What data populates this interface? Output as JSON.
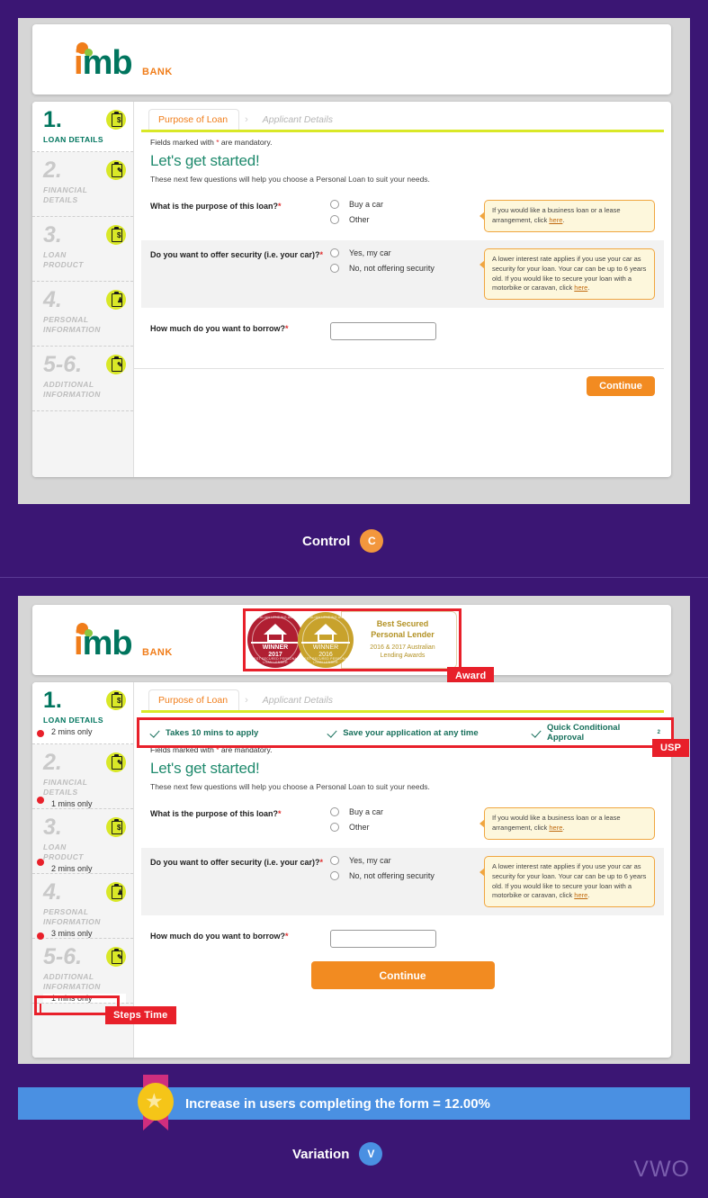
{
  "meta": {
    "tool_logo": "VWO",
    "bg_color": "#3b1674",
    "panel_color": "#d6d6d6"
  },
  "brand": {
    "name_i": "i",
    "name_mb": "mb",
    "suffix": "BANK"
  },
  "form": {
    "tabs": {
      "active": "Purpose of Loan",
      "separator": "›",
      "inactive": "Applicant Details"
    },
    "mandatory_note_pre": "Fields marked with ",
    "mandatory_star": "*",
    "mandatory_note_post": " are mandatory.",
    "headline": "Let's get started!",
    "subhead": "These next few questions will help you choose a Personal Loan to suit your needs.",
    "questions": [
      {
        "label": "What is the purpose of this loan?",
        "required": "*",
        "options": [
          "Buy a car",
          "Other"
        ],
        "tip_pre": "If you would like a business loan or a lease arrangement, click ",
        "tip_link": "here",
        "tip_post": "."
      },
      {
        "label": "Do you want to offer security (i.e. your car)?",
        "required": "*",
        "options": [
          "Yes, my car",
          "No, not offering security"
        ],
        "tip_pre": "A lower interest rate applies if you use your car as security for your loan. Your car can be up to 6 years old. If you would like to secure your loan with a motorbike or caravan, click ",
        "tip_link": "here",
        "tip_post": "."
      }
    ],
    "amount_question": {
      "label": "How much do you want to borrow?",
      "required": "*",
      "value": "",
      "placeholder": ""
    },
    "continue_label": "Continue",
    "continue_color": "#f28b21"
  },
  "sidebar": {
    "steps": [
      {
        "num": "1.",
        "label": "LOAN DETAILS",
        "icon": "clipboard-dollar-icon",
        "time": "2 mins only",
        "active": true
      },
      {
        "num": "2.",
        "label": "FINANCIAL DETAILS",
        "icon": "clipboard-pen-icon",
        "time": "1 mins only",
        "active": false
      },
      {
        "num": "3.",
        "label": "LOAN PRODUCT",
        "icon": "magnifier-dollar-icon",
        "time": "2 mins only",
        "active": false
      },
      {
        "num": "4.",
        "label": "PERSONAL INFORMATION",
        "icon": "clipboard-person-icon",
        "time": "3 mins only",
        "active": false
      },
      {
        "num": "5-6.",
        "label": "ADDITIONAL INFORMATION",
        "icon": "clipboard-pen-icon",
        "time": "1 mins only",
        "active": false
      }
    ]
  },
  "variation_extras": {
    "award": {
      "medal_red": {
        "arc_top": "AUSTRALIAN LENDING AWARDS",
        "winner": "WINNER",
        "year": "2017",
        "arc_bottom": "BEST SECURED PERSONAL LOAN LENDER",
        "color": "#b01f32"
      },
      "medal_gold": {
        "arc_top": "AUSTRALIAN LENDING AWARDS",
        "winner": "WINNER",
        "year": "2016",
        "arc_bottom": "BEST SECURED PERSONAL LOAN LENDER",
        "color": "#c8a22c"
      },
      "title": "Best Secured Personal Lender",
      "subtitle": "2016 & 2017 Australian Lending Awards"
    },
    "usp": [
      "Takes 10 mins to apply",
      "Save your application at any time",
      "Quick Conditional Approval"
    ],
    "usp_superscript": "2"
  },
  "annotations": {
    "award_tag": "Award",
    "usp_tag": "USP",
    "steps_time_tag": "Steps Time",
    "tag_color": "#e8202a"
  },
  "labels": {
    "control": {
      "text": "Control",
      "badge": "C",
      "badge_color": "#f2973d"
    },
    "variation": {
      "text": "Variation",
      "badge": "V",
      "badge_color": "#4a90e2"
    }
  },
  "result": {
    "text_pre": "Increase in users completing the form = ",
    "value": "12.00%",
    "bar_color": "#4a90e2"
  }
}
